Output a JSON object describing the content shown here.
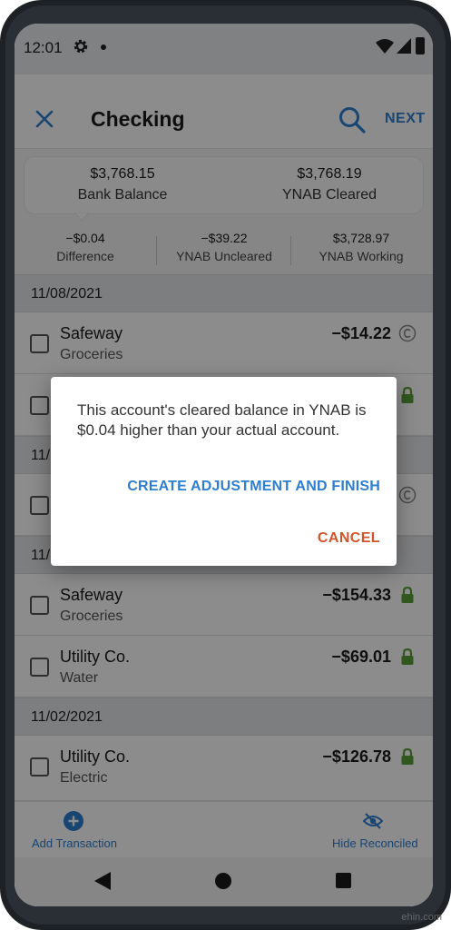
{
  "status_bar": {
    "time": "12:01",
    "icons": [
      "gear-icon",
      "dot-icon",
      "wifi-icon",
      "signal-icon",
      "battery-icon"
    ]
  },
  "header": {
    "title": "Checking",
    "next_label": "NEXT",
    "icons": [
      "close-icon",
      "search-icon"
    ]
  },
  "balance": {
    "bank_amount": "$3,768.15",
    "bank_label": "Bank Balance",
    "cleared_amount": "$3,768.19",
    "cleared_label": "YNAB Cleared"
  },
  "stats": [
    {
      "amount": "−$0.04",
      "label": "Difference"
    },
    {
      "amount": "−$39.22",
      "label": "YNAB Uncleared"
    },
    {
      "amount": "$3,728.97",
      "label": "YNAB Working"
    }
  ],
  "groups": [
    {
      "date": "11/08/2021",
      "transactions": [
        {
          "payee": "Safeway",
          "category": "Groceries",
          "amount": "−$14.22",
          "status_icon": "cleared-icon"
        },
        {
          "payee": "",
          "category": "",
          "amount": "",
          "status_icon": "lock-icon"
        }
      ]
    },
    {
      "date": "11/",
      "transactions": [
        {
          "payee": "",
          "category": "",
          "amount": "",
          "status_icon": "cleared-icon"
        }
      ]
    },
    {
      "date": "11/",
      "transactions": [
        {
          "payee": "Safeway",
          "category": "Groceries",
          "amount": "−$154.33",
          "status_icon": "lock-icon"
        },
        {
          "payee": "Utility Co.",
          "category": "Water",
          "amount": "−$69.01",
          "status_icon": "lock-icon"
        }
      ]
    },
    {
      "date": "11/02/2021",
      "transactions": [
        {
          "payee": "Utility Co.",
          "category": "Electric",
          "amount": "−$126.78",
          "status_icon": "lock-icon"
        }
      ]
    }
  ],
  "actions": {
    "add_label": "Add Transaction",
    "hide_label": "Hide Reconciled"
  },
  "dialog": {
    "message": "This account's cleared balance in YNAB is $0.04 higher than your actual account.",
    "primary_label": "CREATE ADJUSTMENT AND FINISH",
    "cancel_label": "CANCEL"
  },
  "colors": {
    "accent": "#2d7ed0",
    "cancel": "#d0542c",
    "lock": "#5a9e3a"
  },
  "watermark": "ehin.com"
}
